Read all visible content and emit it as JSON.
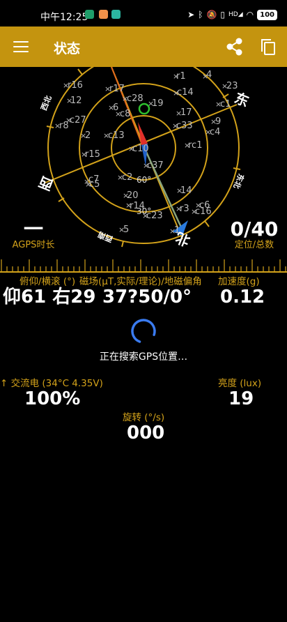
{
  "status_bar": {
    "time": "中午12:25",
    "network": "HD",
    "battery": "100"
  },
  "app_bar": {
    "title": "状态"
  },
  "compass": {
    "directions": {
      "north": "北",
      "east": "东",
      "south": "南",
      "west": "西"
    },
    "intercardinals": {
      "northwest": "西北",
      "northeast": "东北",
      "southeast": "东南",
      "southwest": "西南"
    },
    "ring_labels": [
      "60°",
      "30°"
    ],
    "satellite_labels": [
      {
        "id": "r1"
      },
      {
        "id": "4"
      },
      {
        "id": "r16"
      },
      {
        "id": "r17"
      },
      {
        "id": "c14"
      },
      {
        "id": "23"
      },
      {
        "id": "12"
      },
      {
        "id": "c28"
      },
      {
        "id": "c1"
      },
      {
        "id": "6"
      },
      {
        "id": "19"
      },
      {
        "id": "c27"
      },
      {
        "id": "c8"
      },
      {
        "id": "17"
      },
      {
        "id": "r8"
      },
      {
        "id": "9"
      },
      {
        "id": "c33"
      },
      {
        "id": "2"
      },
      {
        "id": "c13"
      },
      {
        "id": "c4"
      },
      {
        "id": "rc1"
      },
      {
        "id": "c10"
      },
      {
        "id": "r15"
      },
      {
        "id": "c37"
      },
      {
        "id": "c7"
      },
      {
        "id": "c2"
      },
      {
        "id": "c5"
      },
      {
        "id": "20"
      },
      {
        "id": "14"
      },
      {
        "id": "r14"
      },
      {
        "id": "c6"
      },
      {
        "id": "r3"
      },
      {
        "id": "c16"
      },
      {
        "id": "5"
      },
      {
        "id": "c23"
      },
      {
        "id": "1"
      }
    ]
  },
  "agps": {
    "value": "一",
    "label": "AGPS时长"
  },
  "fix": {
    "value": "0/40",
    "label": "定位/总数"
  },
  "orientation": {
    "label": "俯仰/横滚 (°)",
    "value": "仰61 右29"
  },
  "magnetic": {
    "label": "磁场(μT,实际/理论)/地磁偏角",
    "value": "37?50/0°"
  },
  "acceleration": {
    "label": "加速度(g)",
    "value": "0.12"
  },
  "searching_text": "正在搜索GPS位置…",
  "battery_info": {
    "label": "↑ 交流电 (34°C 4.35V)",
    "value": "100%"
  },
  "brightness": {
    "label": "亮度 (lux)",
    "value": "19"
  },
  "rotation": {
    "label": "旋转 (°/s)",
    "value": "000"
  },
  "colors": {
    "accent": "#c4940f",
    "label_gold": "#d3a21a",
    "background": "#000000"
  }
}
